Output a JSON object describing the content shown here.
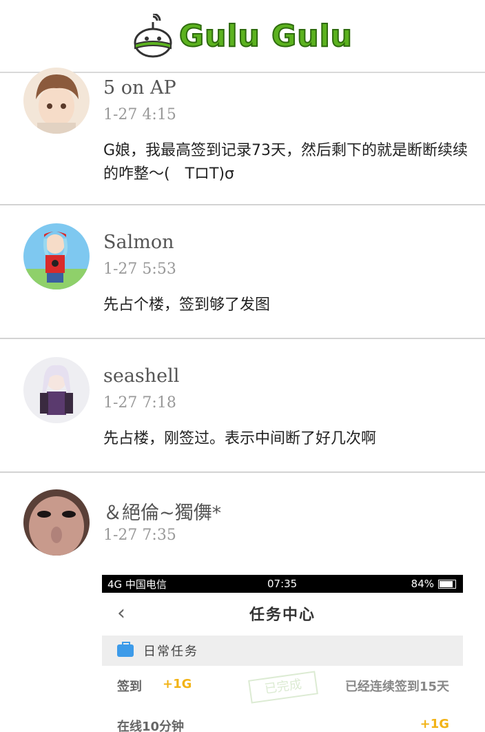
{
  "header": {
    "logo_text": "Gulu Gulu"
  },
  "posts": [
    {
      "username": "5 on AP",
      "time": "1-27 4:15",
      "content": "G娘，我最高签到记录73天，然后剩下的就是断断续续的咋整～(　TロT)σ",
      "avatar_colors": [
        "#e8d5c4",
        "#8b5a3c"
      ]
    },
    {
      "username": "Salmon",
      "time": "1-27 5:53",
      "content": "先占个楼，签到够了发图",
      "avatar_colors": [
        "#7ec8f0",
        "#d92b2b"
      ]
    },
    {
      "username": "seashell",
      "time": "1-27 7:18",
      "content": "先占楼，刚签过。表示中间断了好几次啊",
      "avatar_colors": [
        "#eaeaf0",
        "#5a3a6e"
      ]
    },
    {
      "username": "＆絕倫~獨儛*",
      "time": "1-27 7:35",
      "content": "",
      "avatar_colors": [
        "#6b5048",
        "#d3a89a"
      ]
    }
  ],
  "attached_screenshot": {
    "status_carrier": "4G 中国电信",
    "status_time": "07:35",
    "status_battery": "84%",
    "back_symbol": "‹",
    "title": "任务中心",
    "section": "日常任务",
    "tasks": [
      {
        "name": "签到",
        "reward": "+1G",
        "stamp": "已完成",
        "status": "已经连续签到15天"
      },
      {
        "name": "在线10分钟",
        "reward": "+1G",
        "stamp": "",
        "status": ""
      }
    ],
    "colors": {
      "reward": "#f2b316",
      "accent": "#3d9be9"
    }
  }
}
